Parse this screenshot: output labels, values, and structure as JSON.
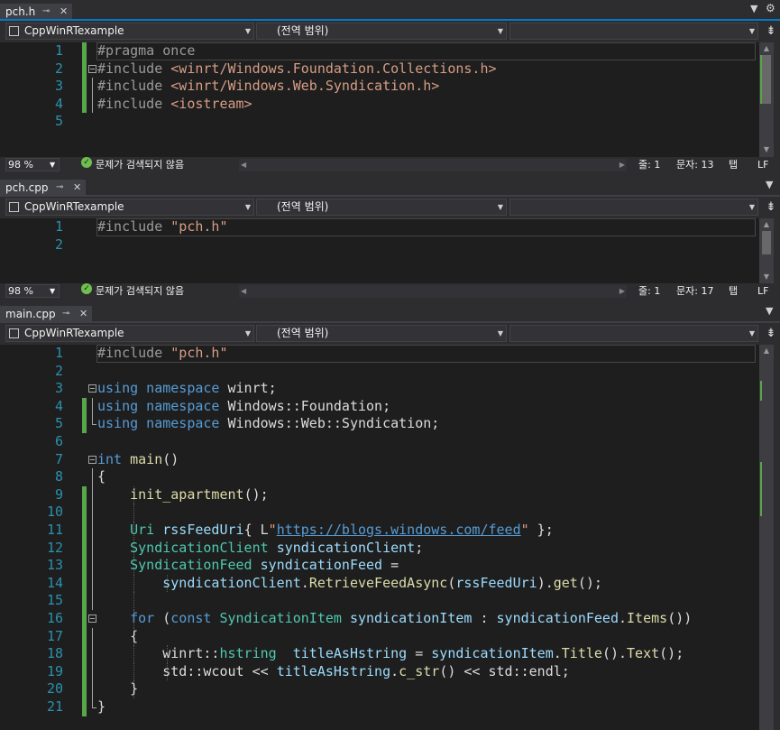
{
  "panes": [
    {
      "tab": "pch.h",
      "project": "CppWinRTexample",
      "scope": "(전역 범위)",
      "zoom": "98 %",
      "issues": "문제가 검색되지 않음",
      "line_label": "줄: 1",
      "col_label": "문자: 13",
      "tab_label": "탭",
      "eol_label": "LF"
    },
    {
      "tab": "pch.cpp",
      "project": "CppWinRTexample",
      "scope": "(전역 범위)",
      "zoom": "98 %",
      "issues": "문제가 검색되지 않음",
      "line_label": "줄: 1",
      "col_label": "문자: 17",
      "tab_label": "탭",
      "eol_label": "LF"
    },
    {
      "tab": "main.cpp",
      "project": "CppWinRTexample",
      "scope": "(전역 범위)"
    }
  ],
  "code": {
    "pch_h": [
      [
        {
          "t": "#pragma once",
          "c": "pp"
        }
      ],
      [
        {
          "t": "#include ",
          "c": "pp"
        },
        {
          "t": "<winrt/Windows.Foundation.Collections.h>",
          "c": "str"
        }
      ],
      [
        {
          "t": "#include ",
          "c": "pp"
        },
        {
          "t": "<winrt/Windows.Web.Syndication.h>",
          "c": "str"
        }
      ],
      [
        {
          "t": "#include ",
          "c": "pp"
        },
        {
          "t": "<iostream>",
          "c": "str"
        }
      ],
      []
    ],
    "pch_cpp": [
      [
        {
          "t": "#include ",
          "c": "pp"
        },
        {
          "t": "\"pch.h\"",
          "c": "str"
        }
      ],
      []
    ],
    "main_cpp": [
      [
        {
          "t": "#include ",
          "c": "pp"
        },
        {
          "t": "\"pch.h\"",
          "c": "str"
        }
      ],
      [],
      [
        {
          "t": "using namespace ",
          "c": "kw"
        },
        {
          "t": "winrt;",
          "c": "ns"
        }
      ],
      [
        {
          "t": "using namespace ",
          "c": "kw"
        },
        {
          "t": "Windows::Foundation;",
          "c": "ns"
        }
      ],
      [
        {
          "t": "using namespace ",
          "c": "kw"
        },
        {
          "t": "Windows::Web::Syndication;",
          "c": "ns"
        }
      ],
      [],
      [
        {
          "t": "int ",
          "c": "kw"
        },
        {
          "t": "main",
          "c": "fn"
        },
        {
          "t": "()",
          "c": "ns"
        }
      ],
      [
        {
          "t": "{",
          "c": "ns"
        }
      ],
      [
        {
          "t": "    ",
          "c": "ns"
        },
        {
          "t": "init_apartment",
          "c": "fn"
        },
        {
          "t": "();",
          "c": "ns"
        }
      ],
      [],
      [
        {
          "t": "    ",
          "c": "ns"
        },
        {
          "t": "Uri ",
          "c": "typ"
        },
        {
          "t": "rssFeedUri",
          "c": "var"
        },
        {
          "t": "{ L",
          "c": "ns"
        },
        {
          "t": "\"",
          "c": "str"
        },
        {
          "t": "https://blogs.windows.com/feed",
          "c": "lnk"
        },
        {
          "t": "\"",
          "c": "str"
        },
        {
          "t": " };",
          "c": "ns"
        }
      ],
      [
        {
          "t": "    ",
          "c": "ns"
        },
        {
          "t": "SyndicationClient ",
          "c": "typ"
        },
        {
          "t": "syndicationClient",
          "c": "var"
        },
        {
          "t": ";",
          "c": "ns"
        }
      ],
      [
        {
          "t": "    ",
          "c": "ns"
        },
        {
          "t": "SyndicationFeed ",
          "c": "typ"
        },
        {
          "t": "syndicationFeed",
          "c": "var"
        },
        {
          "t": " =",
          "c": "ns"
        }
      ],
      [
        {
          "t": "        ",
          "c": "ns"
        },
        {
          "t": "syndicationClient",
          "c": "var"
        },
        {
          "t": ".",
          "c": "ns"
        },
        {
          "t": "RetrieveFeedAsync",
          "c": "fn"
        },
        {
          "t": "(",
          "c": "ns"
        },
        {
          "t": "rssFeedUri",
          "c": "var"
        },
        {
          "t": ").",
          "c": "ns"
        },
        {
          "t": "get",
          "c": "fn"
        },
        {
          "t": "();",
          "c": "ns"
        }
      ],
      [],
      [
        {
          "t": "    ",
          "c": "ns"
        },
        {
          "t": "for ",
          "c": "kw"
        },
        {
          "t": "(",
          "c": "ns"
        },
        {
          "t": "const ",
          "c": "kw"
        },
        {
          "t": "SyndicationItem ",
          "c": "typ"
        },
        {
          "t": "syndicationItem",
          "c": "var"
        },
        {
          "t": " : ",
          "c": "ns"
        },
        {
          "t": "syndicationFeed",
          "c": "var"
        },
        {
          "t": ".",
          "c": "ns"
        },
        {
          "t": "Items",
          "c": "fn"
        },
        {
          "t": "())",
          "c": "ns"
        }
      ],
      [
        {
          "t": "    {",
          "c": "ns"
        }
      ],
      [
        {
          "t": "        winrt::",
          "c": "ns"
        },
        {
          "t": "hstring ",
          "c": "typ"
        },
        {
          "t": " titleAsHstring",
          "c": "var"
        },
        {
          "t": " = ",
          "c": "ns"
        },
        {
          "t": "syndicationItem",
          "c": "var"
        },
        {
          "t": ".",
          "c": "ns"
        },
        {
          "t": "Title",
          "c": "fn"
        },
        {
          "t": "().",
          "c": "ns"
        },
        {
          "t": "Text",
          "c": "fn"
        },
        {
          "t": "();",
          "c": "ns"
        }
      ],
      [
        {
          "t": "        std::wcout << ",
          "c": "ns"
        },
        {
          "t": "titleAsHstring",
          "c": "var"
        },
        {
          "t": ".",
          "c": "ns"
        },
        {
          "t": "c_str",
          "c": "fn"
        },
        {
          "t": "() << std::endl;",
          "c": "ns"
        }
      ],
      [
        {
          "t": "    }",
          "c": "ns"
        }
      ],
      [
        {
          "t": "}",
          "c": "ns"
        }
      ]
    ]
  },
  "icons": {
    "pin": "pin-icon",
    "close": "close-icon",
    "dropdown": "chevron-down-icon",
    "settings": "gear-icon",
    "split": "split-window-icon",
    "ok": "check-circle-icon"
  },
  "colors": {
    "keyword": "#569cd6",
    "type": "#4ec9b0",
    "string": "#d69d85",
    "function": "#dcdcaa",
    "variable": "#9cdcfe",
    "line_number": "#2b91af",
    "change_bar": "#57a64a"
  }
}
